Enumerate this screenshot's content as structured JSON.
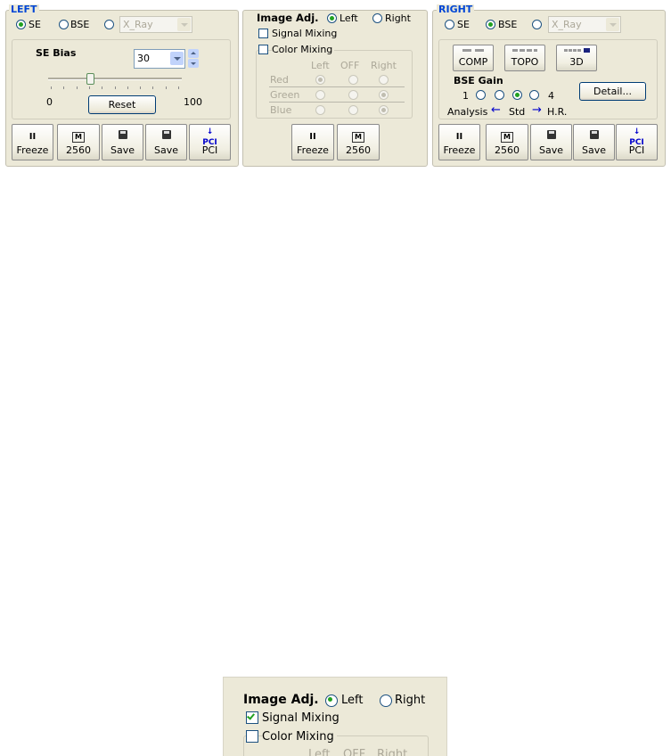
{
  "left": {
    "title": "LEFT",
    "signal_options": [
      "SE",
      "BSE",
      ""
    ],
    "signal_selected": "SE",
    "xray_value": "X_Ray",
    "se_bias": {
      "label": "SE Bias",
      "value": "30",
      "min_label": "0",
      "max_label": "100",
      "slider_fraction": 0.3,
      "reset_label": "Reset"
    },
    "toolbar": [
      "Freeze",
      "2560",
      "Save",
      "Save",
      "PCI"
    ]
  },
  "image_adj": {
    "title": "Image Adj.",
    "target_left": "Left",
    "target_right": "Right",
    "target_selected": "Left",
    "signal_mixing": "Signal Mixing",
    "color_mixing": "Color Mixing",
    "columns": [
      "Left",
      "OFF",
      "Right"
    ],
    "rows": [
      {
        "label": "Red",
        "selected": "Left"
      },
      {
        "label": "Green",
        "selected": "Right"
      },
      {
        "label": "Blue",
        "selected": "Right"
      }
    ],
    "toolbar": [
      "Freeze",
      "2560"
    ]
  },
  "right": {
    "title": "RIGHT",
    "signal_options": [
      "SE",
      "BSE",
      ""
    ],
    "signal_selected": "BSE",
    "xray_value": "X_Ray",
    "modes": [
      "COMP",
      "TOPO",
      "3D"
    ],
    "bse_gain": {
      "label": "BSE Gain",
      "min": "1",
      "max": "4",
      "selected_index": 2,
      "analysis": "Analysis",
      "std": "Std",
      "hr": "H.R."
    },
    "detail_label": "Detail...",
    "toolbar": [
      "Freeze",
      "2560",
      "Save",
      "Save",
      "PCI"
    ]
  },
  "zoom": {
    "title": "Image Adj.",
    "target_left": "Left",
    "target_right": "Right",
    "signal_mixing": "Signal Mixing",
    "signal_mixing_checked": true,
    "color_mixing": "Color Mixing",
    "columns": [
      "Left",
      "OFF",
      "Right"
    ]
  }
}
